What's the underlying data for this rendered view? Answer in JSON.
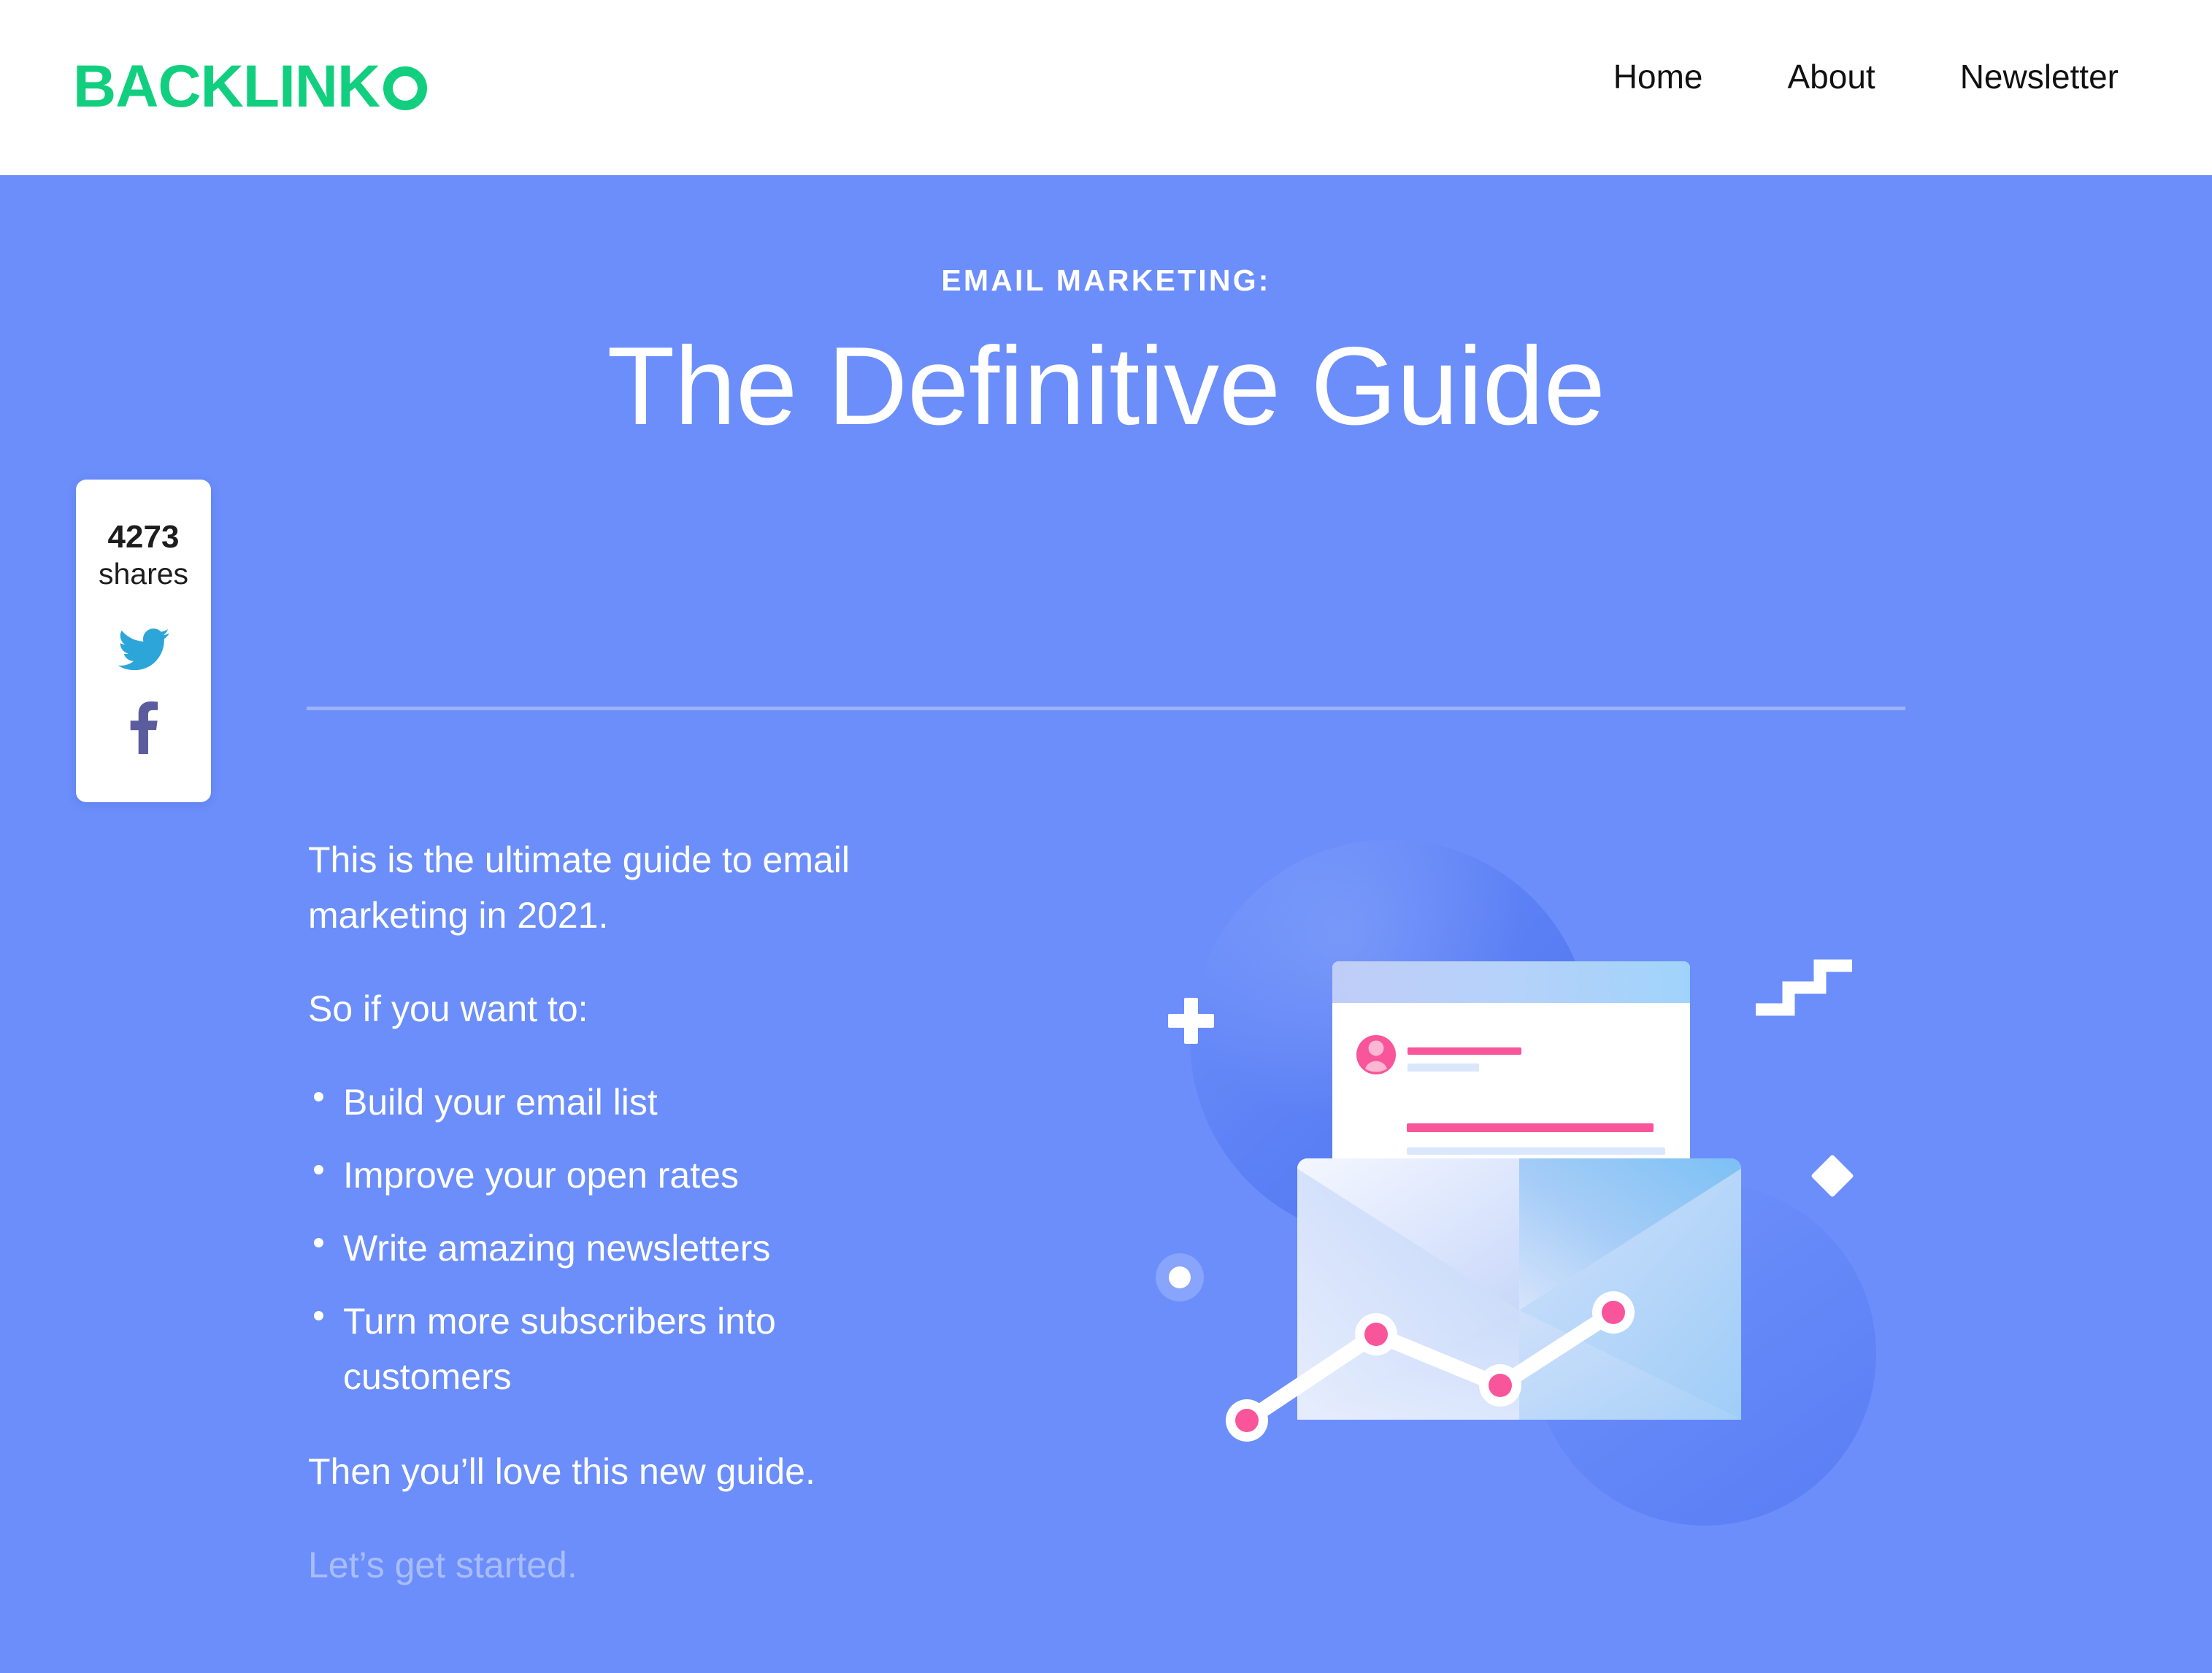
{
  "header": {
    "brand_word": "BACKLINK",
    "brand_ring_icon": "dashed-circle-o-icon",
    "brand_color": "#11cf7e",
    "nav": [
      {
        "label": "Home"
      },
      {
        "label": "About"
      },
      {
        "label": "Newsletter"
      }
    ]
  },
  "hero": {
    "background_color": "#6b8efb",
    "eyebrow": "EMAIL MARKETING:",
    "title": "The Definitive Guide",
    "divider_color": "#9db2f7"
  },
  "share_widget": {
    "count": "4273",
    "label": "shares",
    "buttons": [
      {
        "icon": "twitter-icon",
        "color": "#2ca5d8"
      },
      {
        "icon": "facebook-icon",
        "color": "#5b5c9d"
      }
    ]
  },
  "copy": {
    "lead": "This is the ultimate guide to email marketing in 2021.",
    "prompt": "So if you want to:",
    "benefits": [
      "Build your email list",
      "Improve your open rates",
      "Write amazing newsletters",
      "Turn more subscribers into customers"
    ],
    "closing": "Then you’ll love this new guide.",
    "cta_line": "Let’s get started."
  },
  "illustration": {
    "name": "open-envelope-with-newsletter-and-growth-chart",
    "accent_pink": "#f9559a",
    "envelope_blue": "#9ec8f5",
    "decorations": [
      {
        "icon": "plus-icon",
        "color": "#ffffff"
      },
      {
        "icon": "zigzag-icon",
        "color": "#ffffff"
      },
      {
        "icon": "diamond-icon",
        "color": "#ffffff"
      },
      {
        "icon": "dot-in-ring-icon",
        "color": "#ffffff"
      }
    ],
    "chart_nodes": 4
  }
}
